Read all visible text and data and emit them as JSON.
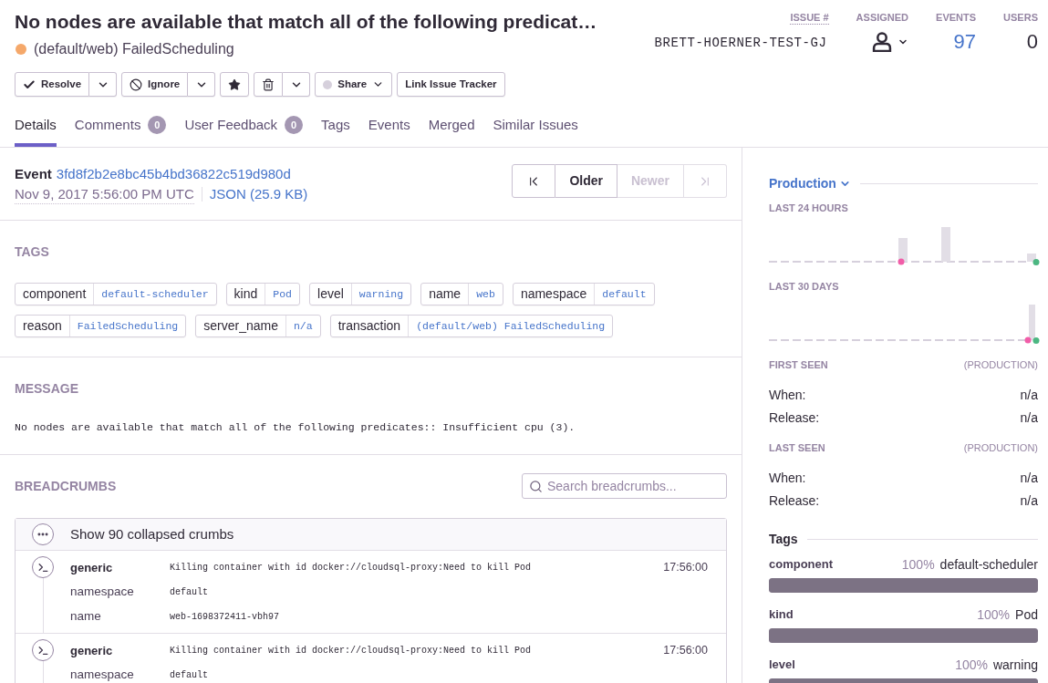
{
  "issue": {
    "title": "No nodes are available that match all of the following predicat…",
    "color": "#f5a86a",
    "culprit": "(default/web) FailedScheduling"
  },
  "stats": [
    {
      "kind": "id",
      "label": "ISSUE #",
      "value": "BRETT-HOERNER-TEST-GJ"
    },
    {
      "kind": "assignee",
      "label": "ASSIGNED"
    },
    {
      "kind": "link",
      "label": "EVENTS",
      "value": "97"
    },
    {
      "kind": "count",
      "label": "USERS",
      "value": "0"
    }
  ],
  "actions": [
    {
      "kind": "resolve",
      "label": "Resolve",
      "dropdown": true
    },
    {
      "kind": "ignore",
      "label": "Ignore",
      "dropdown": true
    },
    {
      "kind": "bookmark",
      "dropdown": false
    },
    {
      "kind": "delete",
      "dropdown": true
    },
    {
      "kind": "share",
      "label": "Share",
      "on": false,
      "dropdown": false
    },
    {
      "kind": "plain",
      "label": "Link Issue Tracker",
      "dropdown": false
    }
  ],
  "tabs": [
    {
      "label": "Details",
      "selected": true
    },
    {
      "label": "Comments",
      "count": "0",
      "selected": false
    },
    {
      "label": "User Feedback",
      "count": "0",
      "selected": false
    },
    {
      "label": "Tags",
      "selected": false
    },
    {
      "label": "Events",
      "selected": false
    },
    {
      "label": "Merged",
      "selected": false
    },
    {
      "label": "Similar Issues",
      "selected": false
    }
  ],
  "event": {
    "label": "Event",
    "id": "3fd8f2b2e8bc45b4bd36822c519d980d",
    "date": "Nov 9, 2017 5:56:00 PM UTC",
    "json_link": "JSON (25.9 KB)"
  },
  "pager": [
    {
      "kind": "first",
      "disabled": false
    },
    {
      "kind": "text",
      "label": "Older",
      "disabled": false
    },
    {
      "kind": "text",
      "label": "Newer",
      "disabled": true
    },
    {
      "kind": "last",
      "disabled": true
    }
  ],
  "tags": {
    "heading": "TAGS",
    "items": [
      {
        "key": "component",
        "value": "default-scheduler"
      },
      {
        "key": "kind",
        "value": "Pod"
      },
      {
        "key": "level",
        "value": "warning"
      },
      {
        "key": "name",
        "value": "web"
      },
      {
        "key": "namespace",
        "value": "default"
      },
      {
        "key": "reason",
        "value": "FailedScheduling"
      },
      {
        "key": "server_name",
        "value": "n/a"
      },
      {
        "key": "transaction",
        "value": "(default/web) FailedScheduling"
      }
    ]
  },
  "message": {
    "heading": "MESSAGE",
    "text": "No nodes are available that match all of the following predicates:: Insufficient cpu (3)."
  },
  "breadcrumbs": {
    "heading": "BREADCRUMBS",
    "search": {
      "placeholder": "Search breadcrumbs..."
    },
    "collapsed": "Show 90 collapsed crumbs",
    "crumbs": [
      {
        "category": "generic",
        "message": "Killing container with id docker://cloudsql-proxy:Need to kill Pod",
        "time": "17:56:00",
        "data": [
          {
            "key": "namespace",
            "value": "default"
          },
          {
            "key": "name",
            "value": "web-1698372411-vbh97"
          }
        ]
      },
      {
        "category": "generic",
        "message": "Killing container with id docker://cloudsql-proxy:Need to kill Pod",
        "time": "17:56:00",
        "data": [
          {
            "key": "namespace",
            "value": "default"
          }
        ]
      }
    ]
  },
  "sidebar": {
    "environment": "Production",
    "charts": [
      {
        "kind": "hourly",
        "title": "LAST 24 HOURS"
      },
      {
        "kind": "daily",
        "title": "LAST 30 DAYS"
      }
    ],
    "seen": [
      {
        "title": "FIRST SEEN",
        "scope": "(PRODUCTION)",
        "rows": [
          {
            "label": "When:",
            "value": "n/a"
          },
          {
            "label": "Release:",
            "value": "n/a"
          }
        ]
      },
      {
        "title": "LAST SEEN",
        "scope": "(PRODUCTION)",
        "rows": [
          {
            "label": "When:",
            "value": "n/a"
          },
          {
            "label": "Release:",
            "value": "n/a"
          }
        ]
      }
    ],
    "tags": {
      "title": "Tags",
      "items": [
        {
          "key": "component",
          "percent": "100%",
          "value": "default-scheduler",
          "level": 1
        },
        {
          "key": "kind",
          "percent": "100%",
          "value": "Pod",
          "level": 1
        },
        {
          "key": "level",
          "percent": "100%",
          "value": "warning",
          "level": 1
        }
      ]
    }
  }
}
